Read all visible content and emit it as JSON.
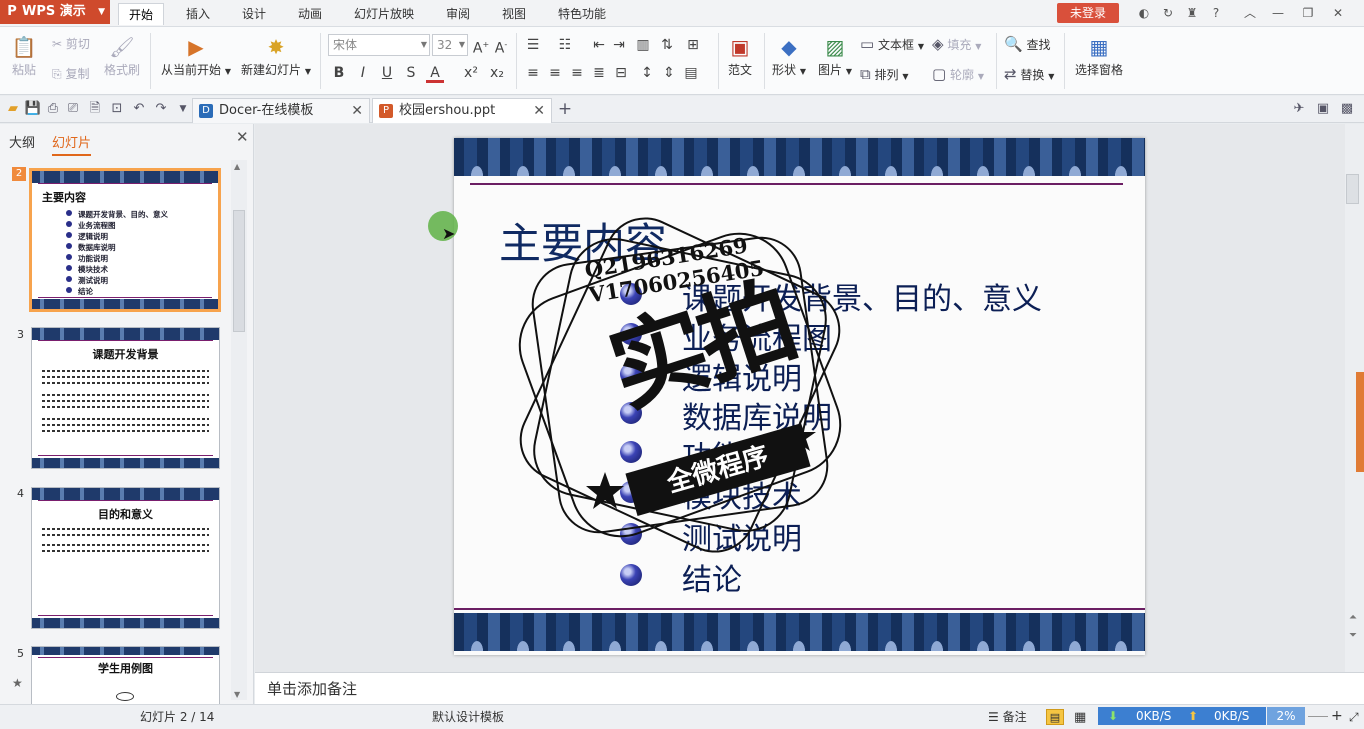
{
  "app": {
    "menu_label": "WPS 演示",
    "login_label": "未登录"
  },
  "menu_tabs": [
    "开始",
    "插入",
    "设计",
    "动画",
    "幻灯片放映",
    "审阅",
    "视图",
    "特色功能"
  ],
  "window_icons": [
    "skin-icon",
    "sync-icon",
    "shirt-icon",
    "help-icon",
    "collapse-icon",
    "minimize-icon",
    "restore-icon",
    "close-icon"
  ],
  "ribbon": {
    "paste": "粘贴",
    "cut": "剪切",
    "copy": "复制",
    "format_painter": "格式刷",
    "from_current": "从当前开始",
    "new_slide": "新建幻灯片",
    "font_name": "宋体",
    "font_size": "32",
    "template": "范文",
    "shape": "形状",
    "picture": "图片",
    "textbox": "文本框",
    "fill": "填充",
    "arrange": "排列",
    "outline": "轮廓",
    "find": "查找",
    "replace": "替换",
    "selection_pane": "选择窗格"
  },
  "tabs": [
    {
      "label": "Docer-在线模板",
      "icon": "docer-icon"
    },
    {
      "label": "校园ershou.ppt",
      "icon": "ppt-file-icon"
    }
  ],
  "panel": {
    "tab_outline": "大纲",
    "tab_slides": "幻灯片"
  },
  "thumbnails": [
    {
      "number": "2",
      "title": "主要内容",
      "items": [
        "课题开发背景、目的、意义",
        "业务流程图",
        "逻辑说明",
        "数据库说明",
        "功能说明",
        "模块技术",
        "测试说明",
        "结论"
      ]
    },
    {
      "number": "3",
      "title": "课题开发背景"
    },
    {
      "number": "4",
      "title": "目的和意义"
    },
    {
      "number": "5",
      "title": "学生用例图"
    }
  ],
  "slide": {
    "title": "主要内容",
    "items": [
      "课题开发背景、目的、意义",
      "业务流程图",
      "逻辑说明",
      "数据库说明",
      "功能说明",
      "模块技术",
      "测试说明",
      "结论"
    ]
  },
  "watermark": {
    "line1": "Q2196316269",
    "line2": "V17060256405",
    "big": "实拍",
    "banner": "全微程序"
  },
  "notes_placeholder": "单击添加备注",
  "status": {
    "slide_count": "幻灯片 2 / 14",
    "template": "默认设计模板",
    "notes_btn": "备注",
    "download": "0KB/S",
    "upload": "0KB/S",
    "zoom": "2%"
  }
}
